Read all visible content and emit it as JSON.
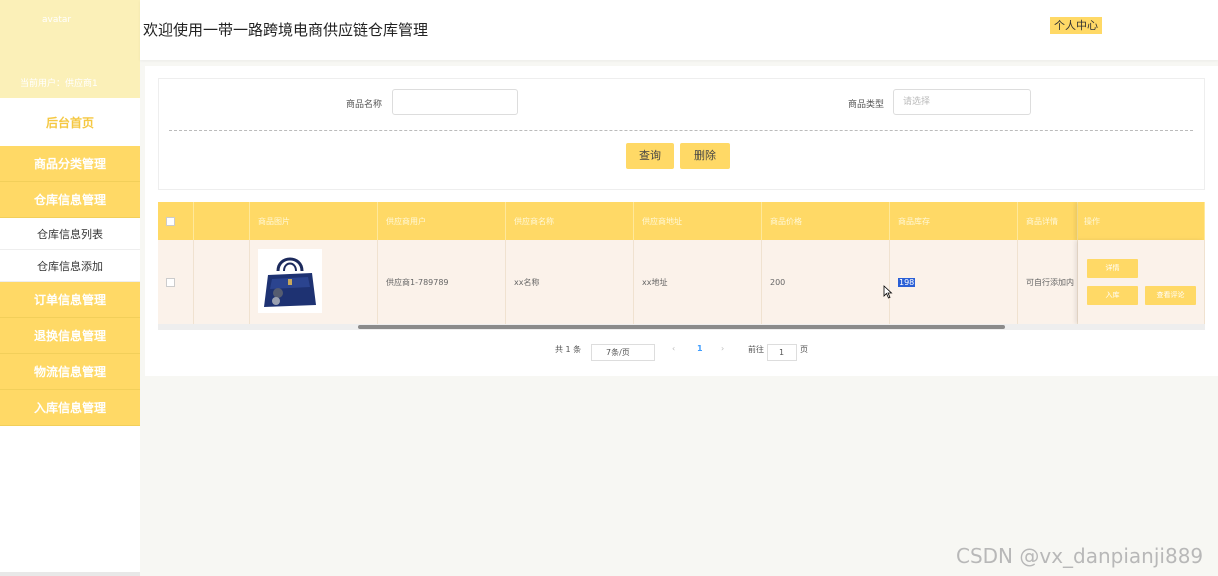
{
  "sidebar": {
    "avatar_label": "avatar",
    "user_label": "当前用户：供应商1",
    "home": "后台首页",
    "groups": [
      "商品分类管理",
      "仓库信息管理"
    ],
    "sub_items": [
      "仓库信息列表",
      "仓库信息添加"
    ],
    "groups2": [
      "订单信息管理",
      "退换信息管理",
      "物流信息管理",
      "入库信息管理"
    ]
  },
  "header": {
    "title": "欢迎使用一带一路跨境电商供应链仓库管理",
    "profile_button": "个人中心"
  },
  "search": {
    "name_label": "商品名称",
    "name_value": "",
    "type_label": "商品类型",
    "type_placeholder": "请选择",
    "query_button": "查询",
    "delete_button": "删除"
  },
  "table": {
    "headers": [
      "商品图片",
      "供应商用户",
      "供应商名称",
      "供应商地址",
      "商品价格",
      "商品库存",
      "商品详情",
      "操作"
    ],
    "row": {
      "supplier_user": "供应商1-789789",
      "supplier_name": "xx名称",
      "supplier_address": "xx地址",
      "price": "200",
      "stock": "198",
      "detail": "可自行添加内"
    },
    "actions": [
      "详情",
      "入库",
      "查看评论"
    ]
  },
  "pagination": {
    "total": "共 1 条",
    "page_size": "7条/页",
    "current_page": "1",
    "goto_label": "前往",
    "goto_value": "1",
    "page_suffix": "页"
  },
  "watermark": "CSDN @vx_danpianji889",
  "colors": {
    "accent": "#ffd966",
    "sidebar_top": "#fbf0b8"
  }
}
